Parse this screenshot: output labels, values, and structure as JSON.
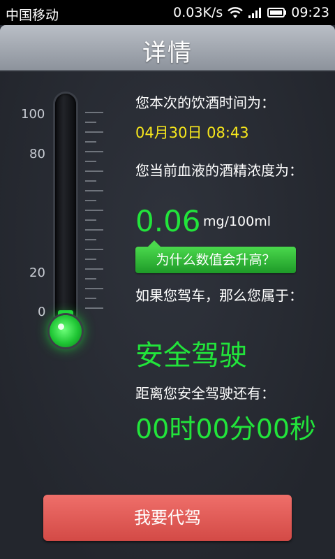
{
  "status_bar": {
    "carrier": "中国移动",
    "network_speed": "0.03K/s",
    "time": "09:23",
    "icons": [
      "wifi-icon",
      "signal-icon",
      "battery-icon"
    ]
  },
  "header": {
    "title": "详情"
  },
  "thermometer": {
    "scale_labels": [
      "100",
      "80",
      "20",
      "0"
    ],
    "level_mg_per_100ml": 0.06,
    "fill_color": "#22d33b"
  },
  "details": {
    "drink_time_label": "您本次的饮酒时间为：",
    "drink_time_value": "04月30日 08:43",
    "bac_label": "您当前血液的酒精浓度为：",
    "bac_value": "0.06",
    "bac_unit": "mg/100ml",
    "why_button": "为什么数值会升高？",
    "driving_label": "如果您驾车，那么您属于：",
    "driving_status": "安全驾驶",
    "countdown_label": "距离您安全驾驶还有：",
    "countdown_value": "00时00分00秒"
  },
  "actions": {
    "designated_driver_button": "我要代驾"
  },
  "colors": {
    "accent_green": "#22e43b",
    "time_yellow": "#f6e61c",
    "button_red": "#e05a56"
  }
}
